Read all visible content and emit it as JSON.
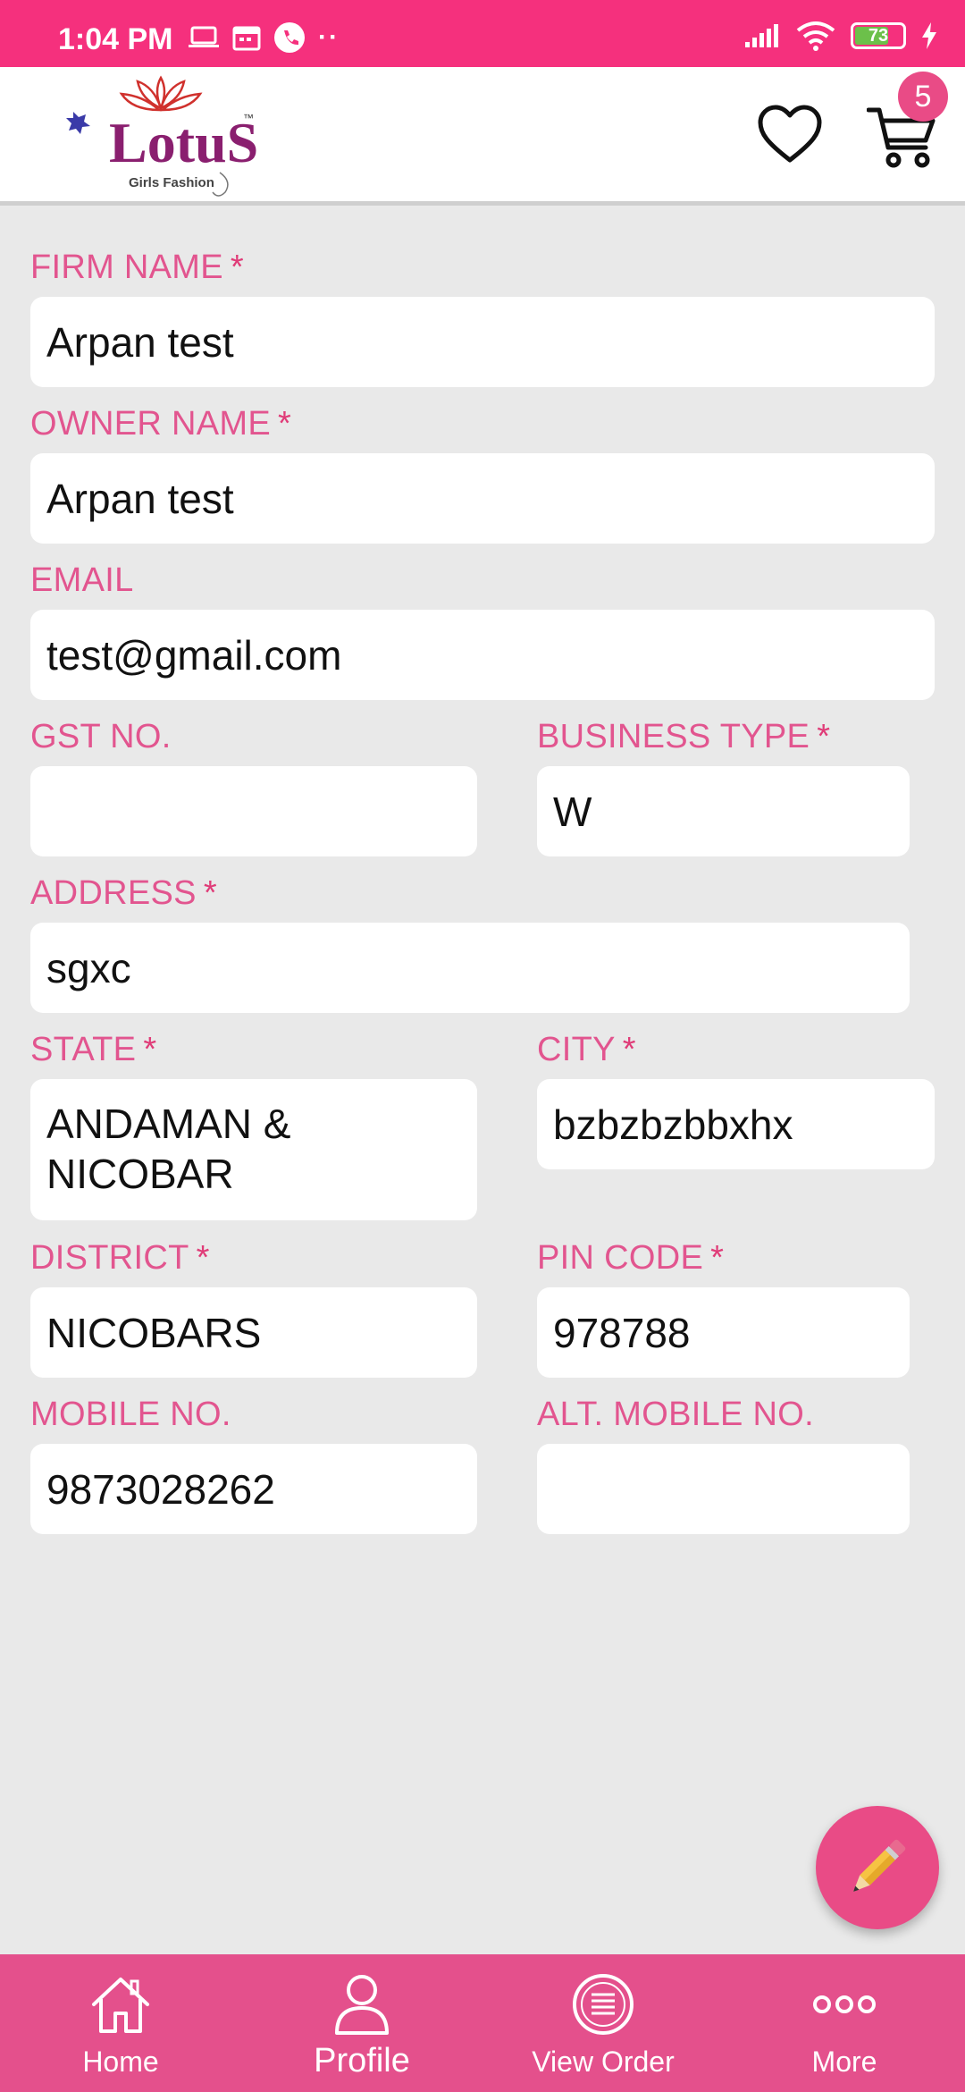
{
  "status_bar": {
    "time": "1:04 PM",
    "battery": "73"
  },
  "header": {
    "brand_text": "LotuS",
    "brand_tagline": "Girls Fashion",
    "trademark": "™",
    "cart_count": "5"
  },
  "form": {
    "firm_name": {
      "label": "FIRM NAME",
      "required": "*",
      "value": "Arpan test"
    },
    "owner_name": {
      "label": "OWNER NAME",
      "required": "*",
      "value": "Arpan test"
    },
    "email": {
      "label": "EMAIL",
      "value": "test@gmail.com"
    },
    "gst_no": {
      "label": "GST NO.",
      "value": ""
    },
    "business_type": {
      "label": "BUSINESS TYPE",
      "required": "*",
      "value": "W"
    },
    "address": {
      "label": "ADDRESS",
      "required": "*",
      "value": "sgxc"
    },
    "state": {
      "label": "STATE",
      "required": "*",
      "value": "ANDAMAN & NICOBAR"
    },
    "city": {
      "label": "CITY",
      "required": "*",
      "value": "bzbzbzbbxhx"
    },
    "district": {
      "label": "DISTRICT",
      "required": "*",
      "value": "NICOBARS"
    },
    "pin_code": {
      "label": "PIN CODE",
      "required": "*",
      "value": "978788"
    },
    "mobile_no": {
      "label": "MOBILE NO.",
      "value": "9873028262"
    },
    "alt_mobile_no": {
      "label": "ALT. MOBILE NO.",
      "value": ""
    }
  },
  "bottom_nav": [
    {
      "label": "Home",
      "icon": "home-icon"
    },
    {
      "label": "Profile",
      "icon": "person-icon"
    },
    {
      "label": "View Order",
      "icon": "list-icon"
    },
    {
      "label": "More",
      "icon": "more-icon"
    }
  ],
  "colors": {
    "status_bar": "#f5307d",
    "accent": "#e94b86",
    "label": "#e2558f",
    "background": "#e9e9e9"
  }
}
